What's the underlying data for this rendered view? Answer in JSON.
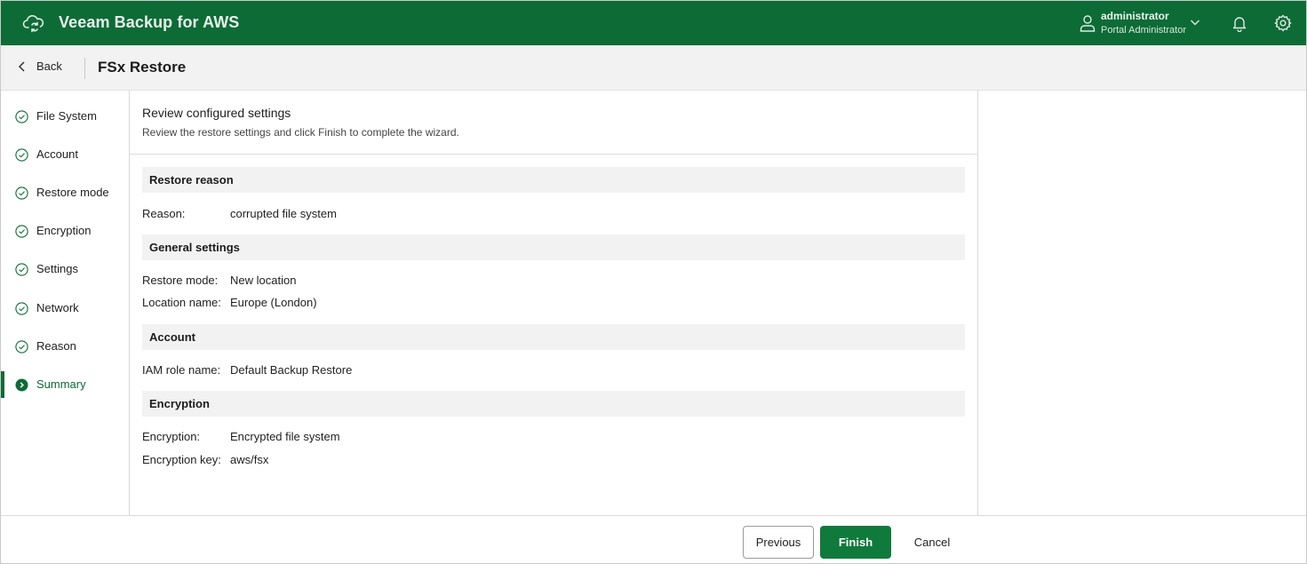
{
  "app": {
    "title": "Veeam Backup for AWS",
    "user_name": "administrator",
    "user_role": "Portal Administrator"
  },
  "header": {
    "back_label": "Back",
    "page_title": "FSx Restore"
  },
  "sidebar": {
    "steps": [
      {
        "label": "File System",
        "state": "done"
      },
      {
        "label": "Account",
        "state": "done"
      },
      {
        "label": "Restore mode",
        "state": "done"
      },
      {
        "label": "Encryption",
        "state": "done"
      },
      {
        "label": "Settings",
        "state": "done"
      },
      {
        "label": "Network",
        "state": "done"
      },
      {
        "label": "Reason",
        "state": "done"
      },
      {
        "label": "Summary",
        "state": "active"
      }
    ]
  },
  "main": {
    "title": "Review configured settings",
    "subtitle": "Review the restore settings and click Finish to complete the wizard.",
    "sections": [
      {
        "title": "Restore reason",
        "rows": [
          {
            "key": "Reason:",
            "value": "corrupted file system"
          }
        ]
      },
      {
        "title": "General settings",
        "rows": [
          {
            "key": "Restore mode:",
            "value": "New location"
          },
          {
            "key": "Location name:",
            "value": "Europe (London)"
          }
        ]
      },
      {
        "title": "Account",
        "rows": [
          {
            "key": "IAM role name:",
            "value": "Default Backup Restore"
          }
        ]
      },
      {
        "title": "Encryption",
        "rows": [
          {
            "key": "Encryption:",
            "value": "Encrypted file system"
          },
          {
            "key": "Encryption key:",
            "value": "aws/fsx"
          }
        ]
      }
    ]
  },
  "footer": {
    "previous_label": "Previous",
    "finish_label": "Finish",
    "cancel_label": "Cancel"
  },
  "colors": {
    "brand_green": "#0d6b36",
    "finish_button": "#0f7a3c",
    "section_header_bg": "#f1f2f1"
  },
  "icons": {
    "logo": "cloud-sync-icon",
    "user": "user-icon",
    "chevron": "chevron-down-icon",
    "notifications": "bell-icon",
    "settings": "gear-icon",
    "back": "chevron-left-icon",
    "step_done": "check-circle-icon",
    "step_active": "arrow-circle-icon"
  }
}
